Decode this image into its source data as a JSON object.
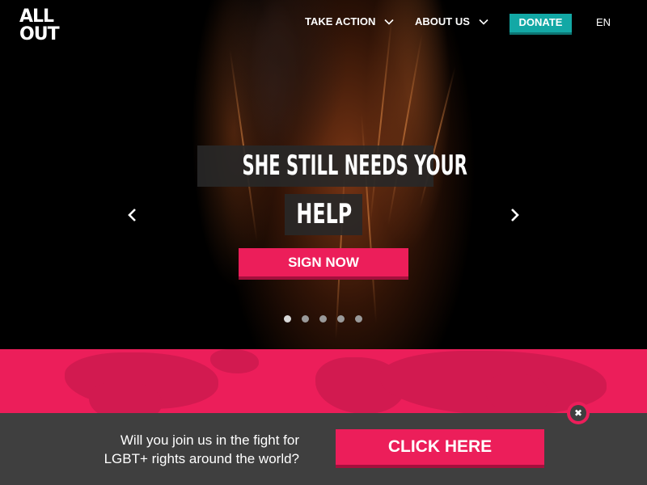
{
  "logo": {
    "line1": "ALL",
    "line2": "OUT"
  },
  "nav": {
    "take_action": "TAKE ACTION",
    "about_us": "ABOUT US",
    "donate": "DONATE",
    "language": "EN"
  },
  "hero": {
    "headline_line1": "SHE STILL NEEDS YOUR",
    "headline_line2": "HELP",
    "cta": "SIGN NOW",
    "slide_count": 5,
    "active_slide": 1
  },
  "banner": {
    "text_line1": "Will you join us in the fight for",
    "text_line2": "LGBT+ rights around the world?",
    "cta": "CLICK HERE"
  },
  "colors": {
    "brand_pink": "#ec1e5a",
    "donate_teal": "#13a8a5",
    "banner_gray": "#3f3f3f"
  },
  "icons": {
    "nav_dropdown": "chevron-down-icon",
    "prev": "chevron-left-icon",
    "next": "chevron-right-icon",
    "close": "close-icon"
  }
}
